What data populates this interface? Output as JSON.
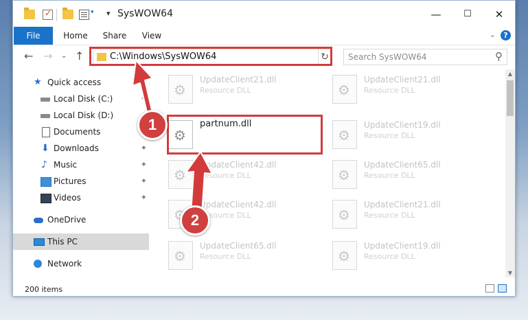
{
  "window": {
    "title": "SysWOW64",
    "controls": {
      "minimize": "—",
      "maximize": "☐",
      "close": "✕"
    }
  },
  "ribbon": {
    "tabs": [
      "File",
      "Home",
      "Share",
      "View"
    ],
    "expand_icon": "chevron-down-icon",
    "help_icon": "?"
  },
  "address_bar": {
    "path": "C:\\Windows\\SysWOW64",
    "search_placeholder": "Search SysWOW64"
  },
  "nav_pane": {
    "items": [
      {
        "label": "Quick access",
        "icon": "star-icon",
        "pinned": false
      },
      {
        "label": "Local Disk (C:)",
        "icon": "drive-icon",
        "pinned": true
      },
      {
        "label": "Local Disk (D:)",
        "icon": "drive-icon",
        "pinned": true
      },
      {
        "label": "Documents",
        "icon": "documents-icon",
        "pinned": true
      },
      {
        "label": "Downloads",
        "icon": "download-icon",
        "pinned": true
      },
      {
        "label": "Music",
        "icon": "music-icon",
        "pinned": true
      },
      {
        "label": "Pictures",
        "icon": "pictures-icon",
        "pinned": true
      },
      {
        "label": "Videos",
        "icon": "videos-icon",
        "pinned": true
      },
      {
        "label": "OneDrive",
        "icon": "cloud-icon",
        "pinned": false
      },
      {
        "label": "This PC",
        "icon": "pc-icon",
        "pinned": false,
        "selected": true
      },
      {
        "label": "Network",
        "icon": "network-icon",
        "pinned": false
      }
    ],
    "pin_glyph": "📌"
  },
  "files": [
    {
      "name": "UpdateClient21.dll",
      "type": "Resource DLL"
    },
    {
      "name": "UpdateClient21.dll",
      "type": "Resource DLL"
    },
    {
      "name": "partnum.dll",
      "type": ""
    },
    {
      "name": "UpdateClient19.dll",
      "type": "Resource DLL"
    },
    {
      "name": "UpdateClient42.dll",
      "type": "Resource DLL"
    },
    {
      "name": "UpdateClient65.dll",
      "type": "Resource DLL"
    },
    {
      "name": "UpdateClient42.dll",
      "type": "Resource DLL"
    },
    {
      "name": "UpdateClient21.dll",
      "type": "Resource DLL"
    },
    {
      "name": "UpdateClient65.dll",
      "type": "Resource DLL"
    },
    {
      "name": "UpdateClient19.dll",
      "type": "Resource DLL"
    }
  ],
  "status": {
    "item_count": "200 items"
  },
  "annotations": {
    "step1": "1",
    "step2": "2",
    "color": "#d33b3b"
  }
}
